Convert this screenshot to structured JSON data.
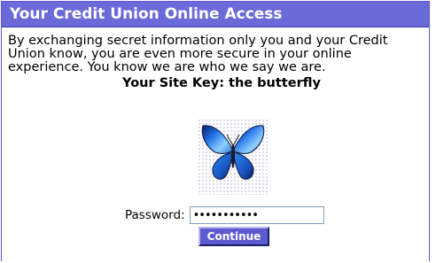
{
  "header": {
    "title": "Your Credit Union Online Access"
  },
  "intro": {
    "text": "By exchanging secret information only you and your Credit Union know, you are even more secure in your online experience. You know we are who we say we are."
  },
  "site_key": {
    "label": "Your Site Key: the butterfly",
    "icon": "butterfly-icon",
    "colors": [
      "#1e6be0",
      "#7fc8ff",
      "#0d1f5a"
    ]
  },
  "login": {
    "password_label": "Password:",
    "password_value": "•••••••••••",
    "continue_label": "Continue"
  },
  "colors": {
    "header_bg": "#6a6ad8",
    "button_bg": "#5b5bcf"
  }
}
